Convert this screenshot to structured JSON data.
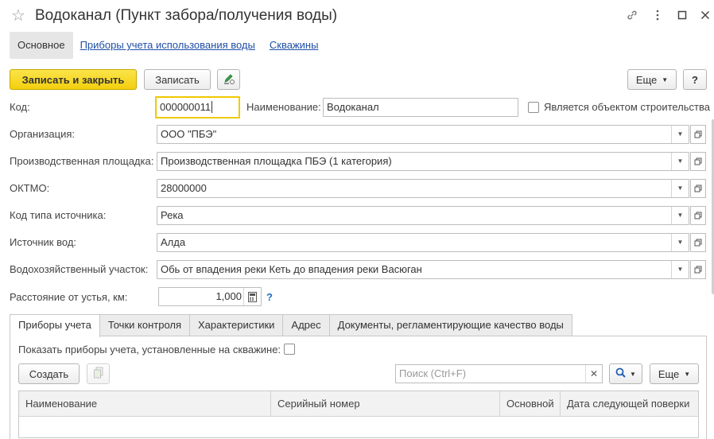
{
  "window": {
    "title": "Водоканал (Пункт забора/получения воды)",
    "icons": [
      "star-icon",
      "link-icon",
      "more-vertical-icon",
      "maximize-icon",
      "close-icon"
    ]
  },
  "nav": {
    "tabs": [
      {
        "label": "Основное"
      },
      {
        "label": "Приборы учета использования воды"
      },
      {
        "label": "Скважины"
      }
    ]
  },
  "toolbar": {
    "save_close": "Записать и закрыть",
    "save": "Записать",
    "more": "Еще",
    "help": "?"
  },
  "form": {
    "code_label": "Код:",
    "code_value": "000000011",
    "name_label": "Наименование:",
    "name_value": "Водоканал",
    "construction_label": "Является объектом строительства",
    "org_label": "Организация:",
    "org_value": "ООО \"ПБЭ\"",
    "site_label": "Производственная площадка:",
    "site_value": "Производственная площадка ПБЭ (1 категория)",
    "oktmo_label": "ОКТМО:",
    "oktmo_value": "28000000",
    "source_type_label": "Код типа источника:",
    "source_type_value": "Река",
    "source_label": "Источник вод:",
    "source_value": "Алда",
    "section_label": "Водохозяйственный участок:",
    "section_value": "Обь от впадения реки Кеть до впадения реки Васюган",
    "distance_label": "Расстояние от устья, км:",
    "distance_value": "1,000",
    "distance_help": "?"
  },
  "tabs": [
    {
      "label": "Приборы учета"
    },
    {
      "label": "Точки контроля"
    },
    {
      "label": "Характеристики"
    },
    {
      "label": "Адрес"
    },
    {
      "label": "Документы, регламентирующие качество воды"
    }
  ],
  "meters": {
    "show_on_well_label": "Показать приборы учета, установленные на скважине:",
    "create": "Создать",
    "search_placeholder": "Поиск (Ctrl+F)",
    "more": "Еще",
    "columns": [
      "Наименование",
      "Серийный номер",
      "Основной",
      "Дата следующей поверки"
    ]
  },
  "colors": {
    "accent_yellow": "#f2cf0e",
    "link_blue": "#1f4fa8",
    "focus_border": "#f0c900"
  }
}
